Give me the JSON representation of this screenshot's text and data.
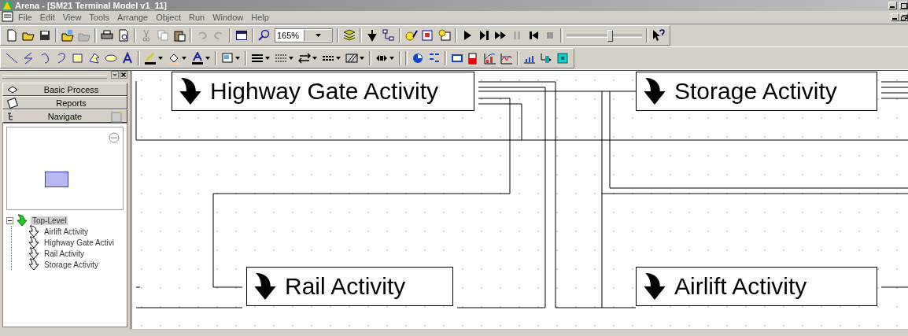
{
  "window": {
    "title": "Arena - [SM21 Terminal Model v1_11]"
  },
  "menu": [
    "File",
    "Edit",
    "View",
    "Tools",
    "Arrange",
    "Object",
    "Run",
    "Window",
    "Help"
  ],
  "toolbar": {
    "zoom": "165%",
    "speed_slider": {
      "level": 0.57
    }
  },
  "panel": {
    "sections": [
      {
        "label": "Basic Process",
        "expanded": false
      },
      {
        "label": "Reports",
        "expanded": false
      },
      {
        "label": "Navigate",
        "expanded": true
      }
    ],
    "tree": [
      {
        "label": "Top-Level",
        "selected": true,
        "expanded": true,
        "children": [
          {
            "label": "Airlift Activity",
            "selected": false
          },
          {
            "label": "Highway Gate Activi",
            "selected": false
          },
          {
            "label": "Rail Activity",
            "selected": false
          },
          {
            "label": "Storage Activity",
            "selected": false
          }
        ]
      }
    ]
  },
  "modules": [
    {
      "label": "Highway Gate Activity"
    },
    {
      "label": "Storage Activity"
    },
    {
      "label": "Rail Activity"
    },
    {
      "label": "Airlift Activity"
    }
  ]
}
